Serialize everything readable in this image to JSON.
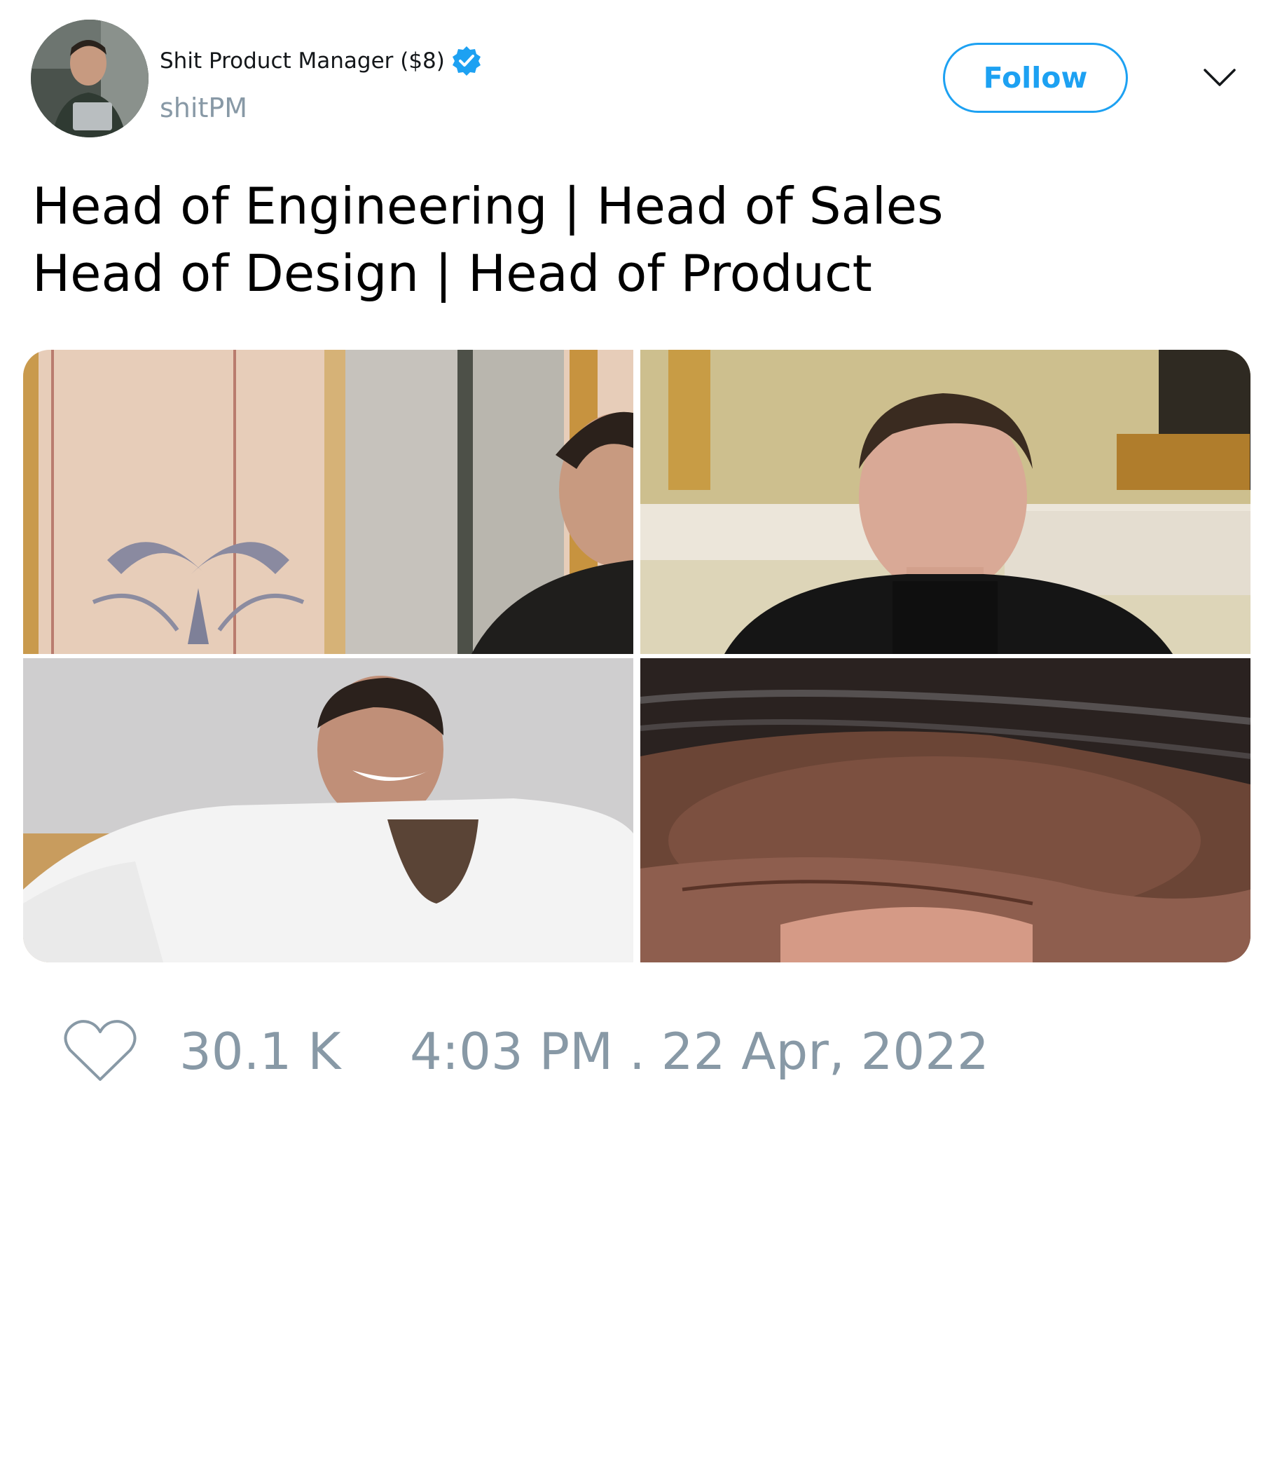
{
  "author": {
    "display_name": "Shit Product Manager ($8)",
    "handle": "shitPM",
    "avatar_icon": "avatar-photo",
    "verified_icon": "verified-badge-icon",
    "verified_color": "#1da1f2"
  },
  "follow_button": {
    "label": "Follow",
    "color": "#1da1f2"
  },
  "menu_icon": "chevron-down-icon",
  "tweet": {
    "lines": [
      "Head of Engineering | Head of Sales",
      "Head of Design | Head of Product"
    ]
  },
  "media": [
    {
      "name": "photo-ornate-wall-partial-face"
    },
    {
      "name": "photo-man-dark-turtleneck"
    },
    {
      "name": "photo-man-white-shirt-laughing"
    },
    {
      "name": "photo-forehead-closeup"
    }
  ],
  "footer": {
    "like_icon": "heart-outline-icon",
    "like_count": "30.1 K",
    "timestamp": "4:03 PM . 22 Apr, 2022",
    "text_color": "#8899a6"
  }
}
